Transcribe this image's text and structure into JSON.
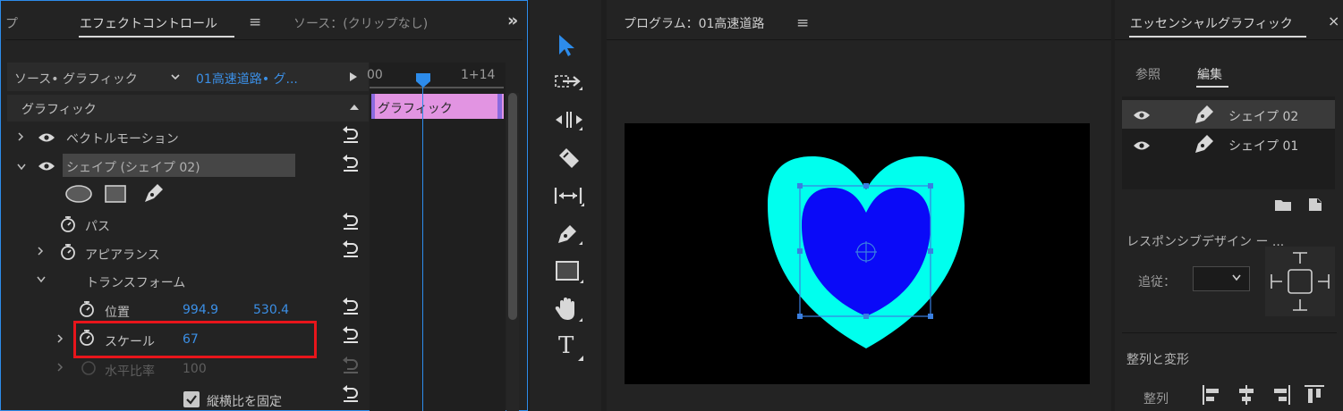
{
  "effect_panel": {
    "tab_prev": "プ",
    "tab_active": "エフェクトコントロール",
    "tab_source": "ソース：(クリップなし)",
    "menu_glyph": "≡",
    "more_glyph": "»",
    "source_label": "ソース• グラフィック",
    "clip_label": "01高速道路• グ...",
    "section_header": "グラフィック",
    "rows": {
      "vector_motion": "ベクトルモーション",
      "shape_selected": "シェイプ (シェイプ 02)",
      "path": "パス",
      "appearance": "アピアランス",
      "transform": "トランスフォーム",
      "position_label": "位置",
      "position_x": "994.9",
      "position_y": "530.4",
      "scale_label": "スケール",
      "scale_value": "67",
      "hscale_label": "水平比率",
      "hscale_value": "100",
      "lock_aspect_label": "縦横比を固定"
    },
    "timeline": {
      "time_start": "00",
      "time_end": "1+14",
      "clip_label": "グラフィック"
    }
  },
  "tools": {
    "items": [
      "selection-tool",
      "track-select-tool",
      "ripple-edit-tool",
      "razor-tool",
      "slip-tool",
      "pen-tool",
      "rectangle-tool",
      "hand-tool",
      "type-tool"
    ],
    "type_glyph": "T"
  },
  "program": {
    "title": "プログラム：01高速道路",
    "menu_glyph": "≡",
    "colors": {
      "outer_heart": "#00ffee",
      "inner_heart": "#0a0af8",
      "background": "#000000",
      "bbox": "#3a7fe0"
    }
  },
  "essential_graphics": {
    "title": "エッセンシャルグラフィック",
    "close_glyph": "×",
    "tab_browse": "参照",
    "tab_edit": "編集",
    "layers": [
      {
        "name": "シェイプ 02",
        "selected": true
      },
      {
        "name": "シェイプ 01",
        "selected": false
      }
    ],
    "responsive_title": "レスポンシブデザイン ー ...",
    "follow_label": "追従：",
    "align_title": "整列と変形",
    "align_label": "整列"
  },
  "highlight": {
    "color": "#e8151b"
  }
}
